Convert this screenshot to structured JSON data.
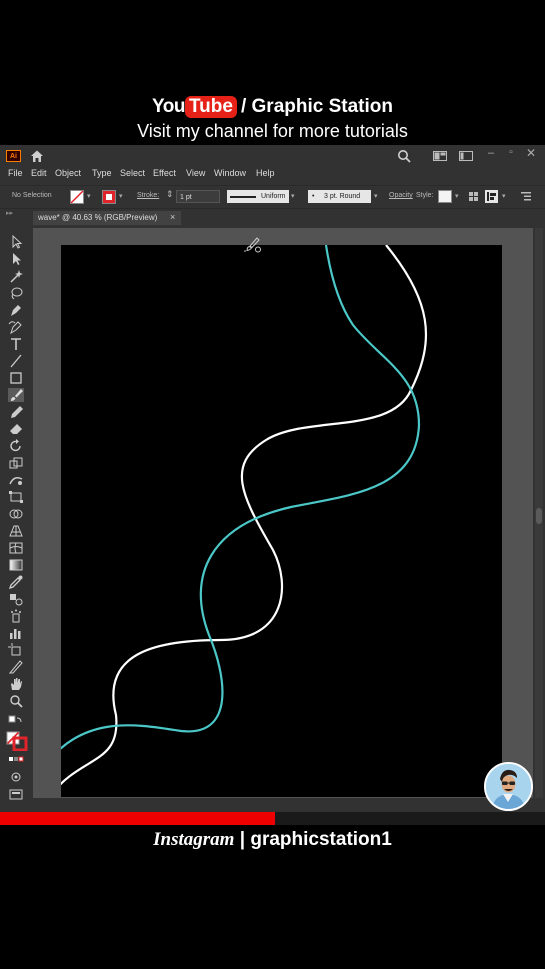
{
  "overlay": {
    "youtube_you": "You",
    "youtube_tube": "Tube",
    "channel_suffix": "/ Graphic Station",
    "subtitle": "Visit my channel for more tutorials",
    "instagram_label": "Instagram",
    "instagram_separator": "|",
    "instagram_handle": "graphicstation1"
  },
  "app": {
    "logo": "Ai",
    "window_controls": {
      "minimize": "–",
      "maximize": "▫",
      "close": "✕"
    },
    "menu": [
      "File",
      "Edit",
      "Object",
      "Type",
      "Select",
      "Effect",
      "View",
      "Window",
      "Help"
    ],
    "control_bar": {
      "selection": "No Selection",
      "stroke_label": "Stroke:",
      "stroke_value": "1 pt",
      "profile": "Uniform",
      "brush": "3 pt. Round",
      "opacity_label": "Opacity",
      "style_label": "Style:"
    },
    "document_tab": {
      "label": "wave* @ 40.63 % (RGB/Preview)",
      "close": "×"
    },
    "tools": [
      "selection-tool-icon",
      "direct-selection-tool-icon",
      "magic-wand-icon",
      "lasso-icon",
      "pen-tool-icon",
      "curvature-tool-icon",
      "type-tool-icon",
      "line-tool-icon",
      "rectangle-tool-icon",
      "paintbrush-tool-icon",
      "pencil-tool-icon",
      "eraser-tool-icon",
      "rotate-tool-icon",
      "scale-tool-icon",
      "puppet-warp-icon",
      "free-transform-icon",
      "shape-builder-icon",
      "perspective-grid-icon",
      "mesh-tool-icon",
      "gradient-tool-icon",
      "eyedropper-icon",
      "blend-tool-icon",
      "symbol-sprayer-icon",
      "column-graph-icon",
      "artboard-tool-icon",
      "slice-tool-icon",
      "hand-tool-icon",
      "zoom-tool-icon"
    ],
    "colors": {
      "ui_bg": "#323232",
      "canvas_bg": "#535353",
      "artboard": "#000000",
      "white_stroke": "#ffffff",
      "cyan_stroke": "#4cc7c8",
      "stroke_swatch": "#e0242b"
    }
  },
  "video": {
    "progress_fraction": 0.505
  }
}
